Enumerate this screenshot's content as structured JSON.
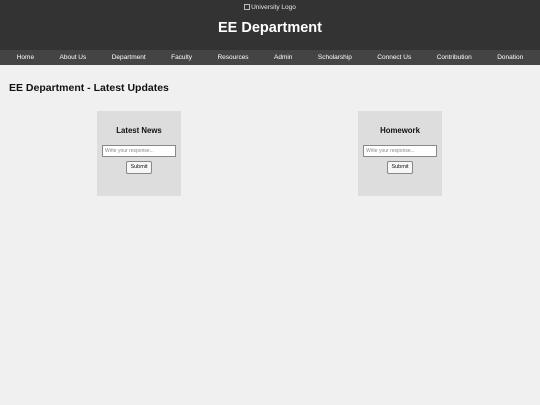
{
  "header": {
    "logo_alt": "University Logo",
    "title": "EE Department"
  },
  "nav": {
    "items": [
      "Home",
      "About Us",
      "Department",
      "Faculty",
      "Resources",
      "Admin",
      "Scholarship",
      "Connect Us",
      "Contribution",
      "Donation"
    ]
  },
  "main": {
    "heading": "EE Department - Latest Updates",
    "cards": [
      {
        "title": "Latest News",
        "placeholder": "Write your response...",
        "submit_label": "Submit"
      },
      {
        "title": "Homework",
        "placeholder": "Write your response...",
        "submit_label": "Submit"
      }
    ]
  },
  "colors": {
    "header_bg": "#333333",
    "nav_bg": "#444444",
    "page_bg": "#f0f0f0",
    "card_bg": "#dddddd"
  }
}
